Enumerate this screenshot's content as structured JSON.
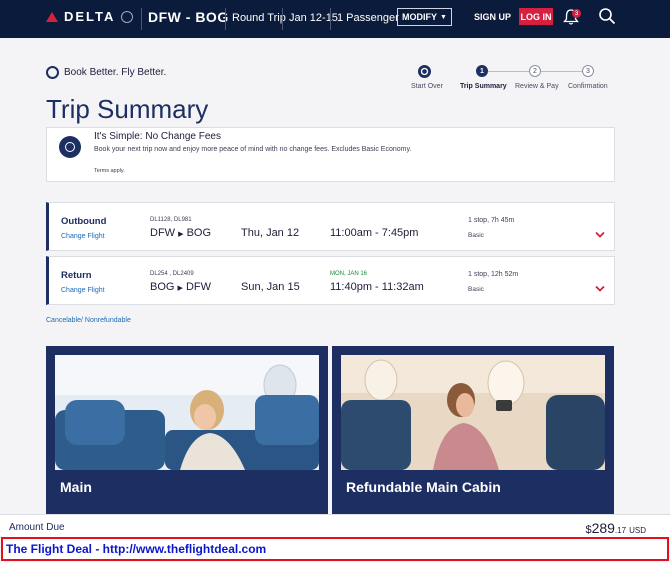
{
  "header": {
    "logo_text": "DELTA",
    "route": "DFW - BOG",
    "trip_type": "Round Trip",
    "dates": "Jan 12-15",
    "passengers": "1 Passenger",
    "modify_label": "MODIFY",
    "signup_label": "SIGN UP",
    "login_label": "LOG IN",
    "notifications_count": "3",
    "icons": [
      "widget-icon",
      "bell-icon",
      "search-icon"
    ]
  },
  "brand": {
    "tagline": "Book Better. Fly Better."
  },
  "progress": {
    "steps": [
      {
        "label": "Start Over",
        "marker": ""
      },
      {
        "label": "Trip Summary",
        "marker": "1"
      },
      {
        "label": "Review & Pay",
        "marker": "2"
      },
      {
        "label": "Confirmation",
        "marker": "3"
      }
    ],
    "active_step": "Trip Summary"
  },
  "page": {
    "title": "Trip Summary"
  },
  "promo": {
    "title": "It's Simple: No Change Fees",
    "subtitle": "Book your next trip now and enjoy more peace of mind with no change fees. Excludes Basic Economy.",
    "terms": "Terms apply."
  },
  "flights": [
    {
      "direction": "Outbound",
      "change_label": "Change Flight",
      "flight_numbers": "DL1128, DL981",
      "origin": "DFW",
      "destination": "BOG",
      "date": "Thu, Jan 12",
      "alert": "",
      "times": "11:00am - 7:45pm",
      "stops": "1 stop, 7h 45m",
      "cabin": "Basic"
    },
    {
      "direction": "Return",
      "change_label": "Change Flight",
      "flight_numbers": "DL254 , DL2409",
      "origin": "BOG",
      "destination": "DFW",
      "date": "Sun, Jan 15",
      "alert": "MON, JAN 16",
      "times": "11:40pm - 11:32am",
      "stops": "1 stop, 12h 52m",
      "cabin": "Basic"
    }
  ],
  "cancel_note": "Cancelable/ Nonrefundable",
  "fares": [
    {
      "name": "Main"
    },
    {
      "name": "Refundable Main Cabin"
    }
  ],
  "amount": {
    "label": "Amount Due",
    "currency_symbol": "$",
    "dollars": "289",
    "cents": ".17",
    "currency": "USD"
  },
  "footer_deal": "The Flight Deal - http://www.theflightdeal.com",
  "colors": {
    "navy": "#0b1b3b",
    "brand_blue": "#1d2f62",
    "red": "#d6203f",
    "link_blue": "#1d6bb8",
    "alert_green": "#1a8a3a"
  }
}
